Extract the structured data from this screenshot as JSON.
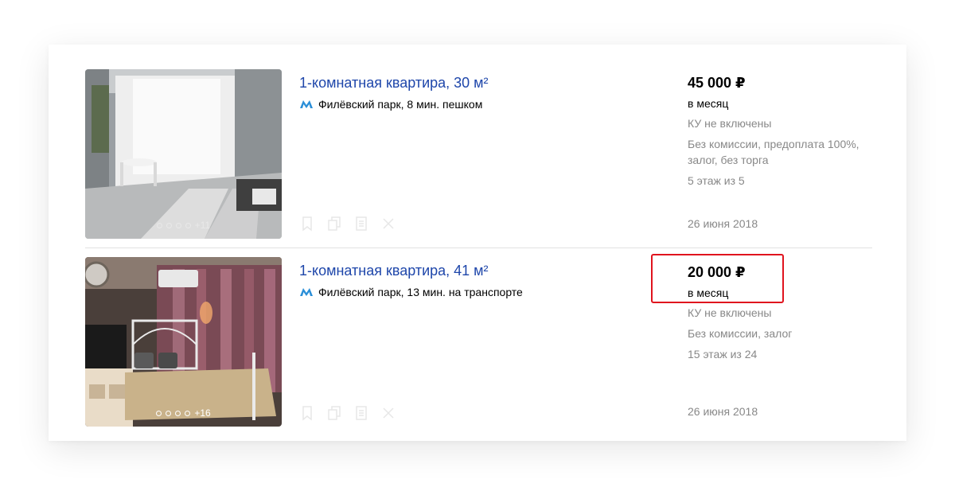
{
  "listings": [
    {
      "title": "1-комнатная квартира, 30 м²",
      "metro": "Филёвский парк, 8 мин. пешком",
      "price": "45 000 ₽",
      "period": "в месяц",
      "utilities": "КУ не включены",
      "terms": "Без комиссии, предоплата 100%, залог, без торга",
      "floor": "5 этаж из 5",
      "date": "26 июня 2018",
      "photo_more": "+11"
    },
    {
      "title": "1-комнатная квартира, 41 м²",
      "metro": "Филёвский парк, 13 мин. на транспорте",
      "price": "20 000 ₽",
      "period": "в месяц",
      "utilities": "КУ не включены",
      "terms": "Без комиссии, залог",
      "floor": "15 этаж из 24",
      "date": "26 июня 2018",
      "photo_more": "+16"
    }
  ],
  "colors": {
    "link": "#1e46aa",
    "metro": "#2b8fd8",
    "highlight": "#e0141e",
    "muted": "#888888"
  }
}
